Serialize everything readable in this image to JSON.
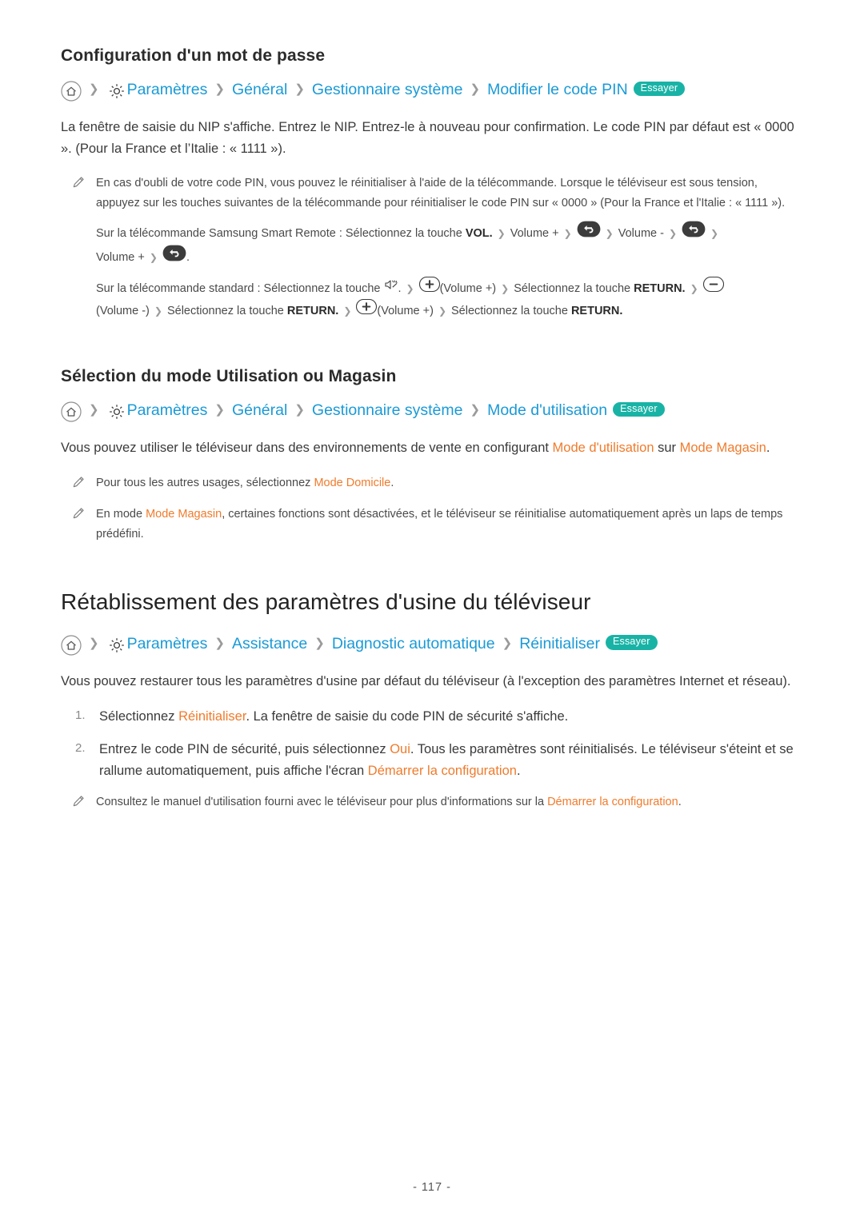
{
  "sections": [
    {
      "title": "Configuration d'un mot de passe",
      "path": {
        "icons": [
          "home-icon",
          "gear-icon"
        ],
        "segments": [
          "Paramètres",
          "Général",
          "Gestionnaire système",
          "Modifier le code PIN"
        ],
        "badge": "Essayer"
      },
      "body": "La fenêtre de saisie du NIP s'affiche. Entrez le NIP. Entrez-le à nouveau pour confirmation. Le code PIN par défaut est « 0000 ». (Pour la France et l’Italie : « 1111 »).",
      "note": {
        "p1": "En cas d'oubli de votre code PIN, vous pouvez le réinitialiser à l'aide de la télécommande. Lorsque le téléviseur est sous tension, appuyez sur les touches suivantes de la télécommande pour réinitialiser le code PIN sur « 0000 » (Pour la France et l'Italie : « 1111 »).",
        "p2_prefix": "Sur la télécommande Samsung Smart Remote : Sélectionnez la touche ",
        "p2_vol": "VOL.",
        "p2_volplus1": "Volume +",
        "p2_volminus": "Volume -",
        "p2_volplus2": "Volume +",
        "p3_prefix": "Sur la télécommande standard : Sélectionnez la touche ",
        "p3_volplus1": "(Volume +)",
        "p3_select1": "Sélectionnez la touche",
        "p3_return1": "RETURN.",
        "p3_volminus": "(Volume -)",
        "p3_select2": "Sélectionnez la touche",
        "p3_return2": "RETURN.",
        "p3_volplus2": "(Volume +)",
        "p3_select3": "Sélectionnez la touche",
        "p3_return3": "RETURN."
      }
    },
    {
      "title": "Sélection du mode Utilisation ou Magasin",
      "path": {
        "segments": [
          "Paramètres",
          "Général",
          "Gestionnaire système",
          "Mode d'utilisation"
        ],
        "badge": "Essayer"
      },
      "body_1": "Vous pouvez utiliser le téléviseur dans des environnements de vente en configurant ",
      "body_hl1": "Mode d'utilisation",
      "body_2": " sur ",
      "body_hl2": "Mode Magasin",
      "body_3": ".",
      "note1_prefix": "Pour tous les autres usages, sélectionnez ",
      "note1_hl": "Mode Domicile",
      "note1_suffix": ".",
      "note2_prefix": "En mode ",
      "note2_hl": "Mode Magasin",
      "note2_suffix": ", certaines fonctions sont désactivées, et le téléviseur se réinitialise automatiquement après un laps de temps prédéfini."
    }
  ],
  "chapter": {
    "title": "Rétablissement des paramètres d'usine du téléviseur",
    "path": {
      "segments": [
        "Paramètres",
        "Assistance",
        "Diagnostic automatique",
        "Réinitialiser"
      ],
      "badge": "Essayer"
    },
    "body": "Vous pouvez restaurer tous les paramètres d'usine par défaut du téléviseur (à l'exception des paramètres Internet et réseau).",
    "steps": [
      {
        "pre": "Sélectionnez ",
        "hl": "Réinitialiser",
        "post": ". La fenêtre de saisie du code PIN de sécurité s'affiche."
      },
      {
        "pre": "Entrez le code PIN de sécurité, puis sélectionnez ",
        "hl": "Oui",
        "post": ". Tous les paramètres sont réinitialisés. Le téléviseur s'éteint et se rallume automatiquement, puis affiche l'écran ",
        "hl2": "Démarrer la configuration",
        "post2": "."
      }
    ],
    "note_prefix": "Consultez le manuel d'utilisation fourni avec le téléviseur pour plus d'informations sur la ",
    "note_hl": "Démarrer la configuration",
    "note_suffix": "."
  },
  "footer": "- 117 -",
  "colors": {
    "link": "#1a9ad7",
    "badge": "#19b3a6",
    "highlight": "#f07b2c"
  }
}
